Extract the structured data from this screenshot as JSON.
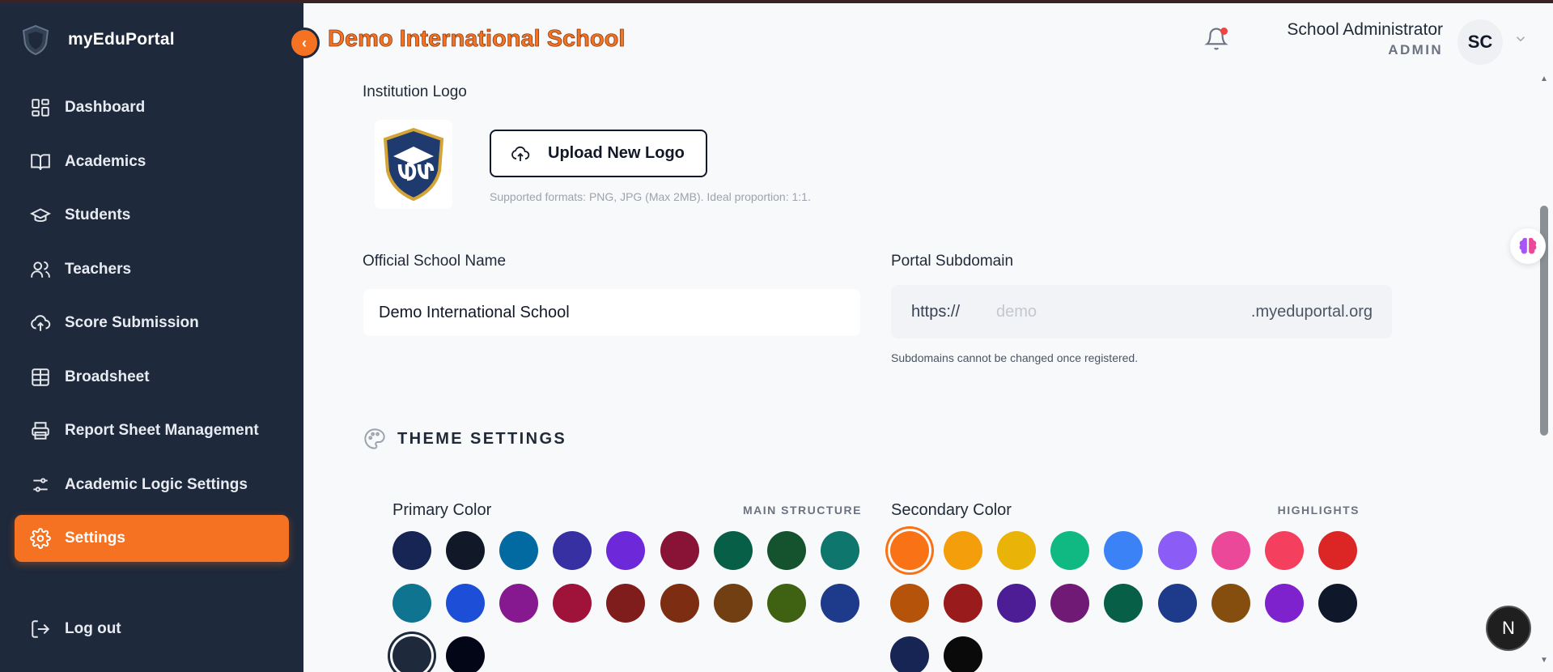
{
  "app": {
    "brand_name": "myEduPortal",
    "school_title": "Demo International School"
  },
  "sidebar": {
    "items": [
      {
        "label": "Dashboard",
        "icon": "dashboard-icon"
      },
      {
        "label": "Academics",
        "icon": "book-icon"
      },
      {
        "label": "Students",
        "icon": "graduation-cap-icon"
      },
      {
        "label": "Teachers",
        "icon": "users-icon"
      },
      {
        "label": "Score Submission",
        "icon": "cloud-upload-icon"
      },
      {
        "label": "Broadsheet",
        "icon": "table-icon"
      },
      {
        "label": "Report Sheet Management",
        "icon": "printer-icon"
      },
      {
        "label": "Academic Logic Settings",
        "icon": "sliders-icon"
      },
      {
        "label": "Settings",
        "icon": "gear-icon",
        "active": true
      }
    ],
    "logout_label": "Log out"
  },
  "header": {
    "user_name": "School Administrator",
    "user_role": "ADMIN",
    "avatar_initials": "SC"
  },
  "form": {
    "logo_label": "Institution Logo",
    "upload_label": "Upload New Logo",
    "upload_hint": "Supported formats: PNG, JPG (Max 2MB). Ideal proportion: 1:1.",
    "school_name_label": "Official School Name",
    "school_name_value": "Demo International School",
    "subdomain_label": "Portal Subdomain",
    "subdomain_prefix": "https://",
    "subdomain_value": "demo",
    "subdomain_suffix": ".myeduportal.org",
    "subdomain_hint": "Subdomains cannot be changed once registered."
  },
  "theme": {
    "heading": "THEME SETTINGS",
    "primary": {
      "label": "Primary Color",
      "tag": "MAIN STRUCTURE",
      "selected_index": 18,
      "colors": [
        "#172554",
        "#111827",
        "#0369a1",
        "#3730a3",
        "#6d28d9",
        "#881337",
        "#065f46",
        "#14532d",
        "#0f766e",
        "#0e7490",
        "#1d4ed8",
        "#86198f",
        "#9f1239",
        "#7f1d1d",
        "#7c2d12",
        "#713f12",
        "#3f6212",
        "#1e3a8a",
        "#1e293b",
        "#020617"
      ]
    },
    "secondary": {
      "label": "Secondary Color",
      "tag": "HIGHLIGHTS",
      "selected_index": 0,
      "colors": [
        "#f97316",
        "#f59e0b",
        "#eab308",
        "#10b981",
        "#3b82f6",
        "#8b5cf6",
        "#ec4899",
        "#f43f5e",
        "#dc2626",
        "#b45309",
        "#991b1b",
        "#4c1d95",
        "#701a75",
        "#065f46",
        "#1e3a8a",
        "#854d0e",
        "#7e22ce",
        "#0f172a",
        "#172554",
        "#0a0a0a"
      ]
    }
  },
  "floating": {
    "n_button_label": "N"
  }
}
